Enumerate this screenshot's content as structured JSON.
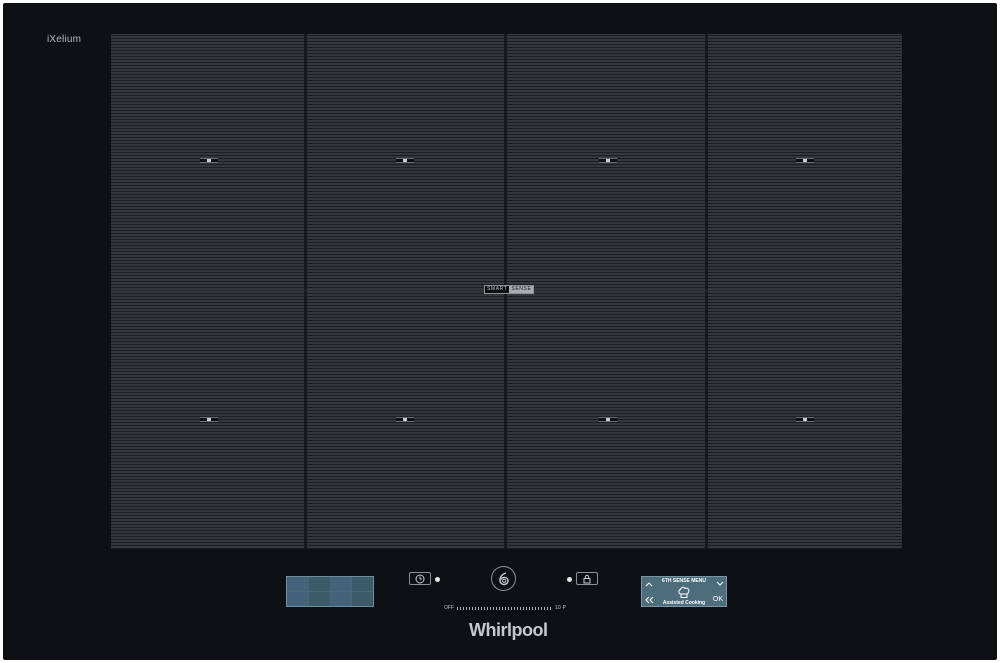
{
  "brand": {
    "series": "iXelium",
    "name": "Whirlpool"
  },
  "surface": {
    "badge_left": "SMART",
    "badge_right": "SENSE"
  },
  "controls": {
    "timer_icon": "clock-icon",
    "sixth_sense_icon": "sixth-sense-icon",
    "lock_icon": "lock-icon",
    "slider": {
      "min_label": "OFF",
      "max_label": "P",
      "mid_label": "10"
    }
  },
  "menu": {
    "title": "6TH SENSE MENU",
    "subtitle": "Assisted Cooking",
    "ok_label": "OK",
    "icons": [
      "chevron-up-icon",
      "chevron-down-icon",
      "back-icon",
      "chef-hat-icon"
    ]
  },
  "colors": {
    "body": "#0e1013",
    "surface": "#2b2d30",
    "panel": "#486777",
    "text": "#c5c8cc"
  }
}
